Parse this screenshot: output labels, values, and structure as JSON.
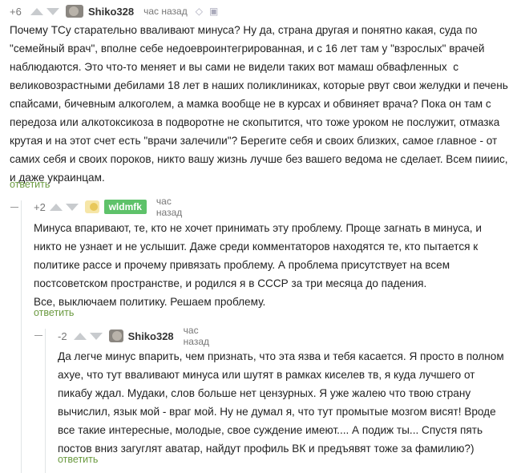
{
  "comments": [
    {
      "rating": "+6",
      "nick": "Shiko328",
      "time": "час назад",
      "body": "Почему ТСу старательно вваливают минуса? Ну да, страна другая и понятно какая, суда по \"семейный врач\", вполне себе недоевроинтегрированная, и с 16 лет там у \"взрослых\" врачей наблюдаются. Это что-то меняет и вы сами не видели таких вот мамаш обвафленных  с великовозрастными дебилами 18 лет в наших поликлиниках, которые рвут свои желудки и печень спайсами, бичевным алкоголем, а мамка вообще не в курсах и обвиняет врача? Пока он там с передоза или алкотоксикоза в подворотне не скопытится, что тоже уроком не послужит, отмазка крутая и на этот счет есть \"врачи залечили\"? Берегите себя и своих близких, самое главное - от самих себя и своих пороков, никто вашу жизнь лучше без вашего ведома не сделает. Всем пииис, и даже украинцам.",
      "reply": "ответить"
    },
    {
      "rating": "+2",
      "nick": "wldmfk",
      "time": "час назад",
      "body": "Минуса впаривают, те, кто не хочет принимать эту проблему. Проще загнать в минуса, и никто не узнает и не услышит. Даже среди комментаторов находятся те, кто пытается к политике рассе и прочему привязать проблему. А проблема присутствует на всем постсоветском пространстве, и родился я в СССР за три месяца до падения.\nВсе, выключаем политику. Решаем проблему.",
      "reply": "ответить"
    },
    {
      "rating": "-2",
      "nick": "Shiko328",
      "time": "час назад",
      "body": "Да легче минус впарить, чем признать, что эта язва и тебя касается. Я просто в полном ахуе, что тут вваливают минуса или шутят в рамках киселев тв, я куда лучшего от пикабу ждал. Мудаки, слов больше нет цензурных. Я уже жалею что твою страну вычислил, язык мой - враг мой. Ну не думал я, что тут промытые мозгом висят! Вроде все такие интересные, молодые, свое суждение имеют.... А подиж ты... Спустя пять постов вниз загуглят аватар, найдут профиль ВК и предъявят тоже за фамилию?)",
      "reply": "ответить"
    }
  ]
}
